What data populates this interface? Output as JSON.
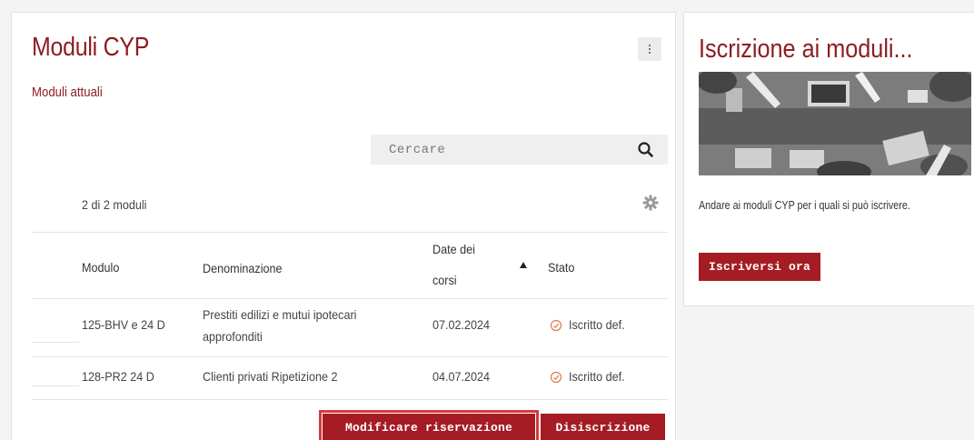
{
  "main": {
    "title": "Moduli CYP",
    "subtitle": "Moduli attuali",
    "search": {
      "placeholder": "Cercare"
    },
    "count_text": "2 di 2 moduli",
    "table": {
      "headers": [
        "Modulo",
        "Denominazione",
        "Date dei corsi",
        "Stato"
      ],
      "date_header_lines": [
        "Date dei",
        "corsi"
      ],
      "rows": [
        {
          "modulo": "125-BHV e 24 D",
          "denominazione_lines": [
            "Prestiti edilizi e mutui ipotecari",
            "approfonditi"
          ],
          "date": "07.02.2024",
          "stato": "Iscritto def."
        },
        {
          "modulo": "128-PR2 24 D",
          "denominazione_lines": [
            "Clienti privati Ripetizione 2"
          ],
          "date": "04.07.2024",
          "stato": "Iscritto def."
        }
      ],
      "sort": {
        "column": "Date dei corsi",
        "direction": "ascending"
      }
    },
    "buttons": {
      "modify": "Modificare riservazione",
      "unsubscribe": "Disiscrizione"
    }
  },
  "side": {
    "title": "Iscrizione ai moduli...",
    "description": "Andare ai moduli CYP per i quali si può iscrivere.",
    "enroll_button": "Iscriversi ora"
  },
  "colors": {
    "brand": "#8c1d21",
    "button": "#a51c24",
    "status_icon": "#e07a4a"
  },
  "icons": {
    "kebab": "kebab-menu-icon",
    "search": "search-icon",
    "settings": "gear-icon",
    "status": "check-circle-icon",
    "caret": "caret-down-icon"
  }
}
